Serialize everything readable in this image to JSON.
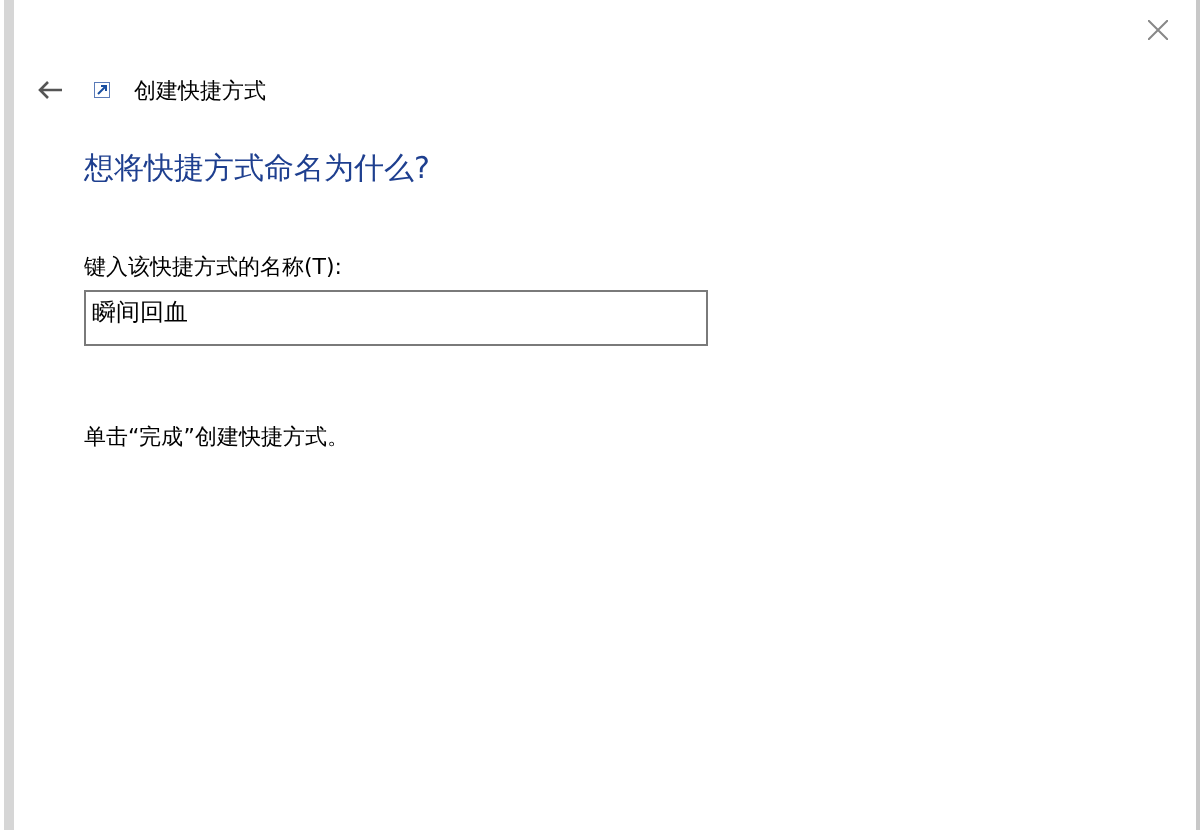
{
  "window": {
    "title": "创建快捷方式"
  },
  "heading": "想将快捷方式命名为什么?",
  "name_field": {
    "label": "键入该快捷方式的名称(T):",
    "value": "瞬间回血"
  },
  "hint": "单击“完成”创建快捷方式。"
}
